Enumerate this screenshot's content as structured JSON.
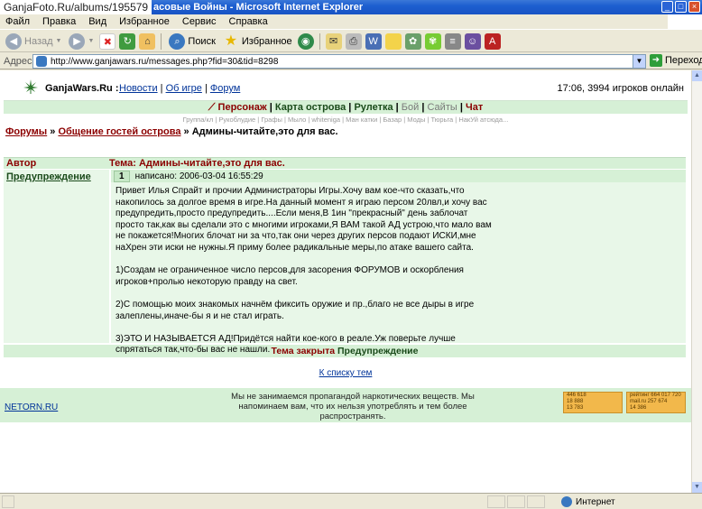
{
  "window": {
    "watermark": "GanjaFoto.Ru/albums/195579",
    "title": "Microsoft Internet Explorer",
    "title_fragment": "асовые Войны",
    "buttons": [
      "_",
      "□",
      "×"
    ]
  },
  "menu": [
    "Файл",
    "Правка",
    "Вид",
    "Избранное",
    "Сервис",
    "Справка"
  ],
  "toolbar": {
    "back": "Назад",
    "search": "Поиск",
    "favorites": "Избранное"
  },
  "address": {
    "label": "Адрес:",
    "url": "http://www.ganjawars.ru/messages.php?fid=30&tid=8298",
    "go": "Переход"
  },
  "site": {
    "logo": "GanjaWars.Ru",
    "logo_sep": ":",
    "nav": [
      "Новости",
      "Об игре",
      "Форум"
    ],
    "status": "17:06, 3994 игроков онлайн",
    "menu": [
      "Персонаж",
      "Карта острова",
      "Рулетка",
      "Бой",
      "Сайты",
      "Чат"
    ],
    "submenu": "Группа/кл | Рукоблудие | Графы | Мыло | whiteniga | Ман катки | Базар | Моды | Тюрьга | НакУй атсюда..."
  },
  "breadcrumb": {
    "forums": "Форумы",
    "sep": "»",
    "section": "Общение гостей острова",
    "topic": "Админы-читайте,это для вас."
  },
  "thread": {
    "col_author": "Автор",
    "col_topic_prefix": "Тема:",
    "topic": "Админы-читайте,это для вас.",
    "post": {
      "author": "Предупреждение",
      "number": "1",
      "meta": "написано: 2006-03-04 16:55:29",
      "paragraphs": [
        "Привет Илья Спрайт и прочии Администраторы Игры.Хочу вам кое-что сказать,что накопилось за долгое время в игре.На данный момент я играю персом 20лвл,и хочу вас предупредить,просто предупредить....Если меня,В 1ин \"прекрасный\" день заблочат просто так,как вы сделали это с многими игроками,Я ВАМ такой АД устрою,что мало вам не покажется!Многих блочат ни за что,так они через других персов подают ИСКИ,мне наХрен эти иски не нужны.Я приму более радикальные меры,по атаке вашего сайта.",
        "1)Создам не ограниченное число персов,для засорения ФОРУМОВ и оскорбления игроков+пролью некоторую правду на свет.",
        "2)С помощью моих знакомых начнём фиксить оружие и пр.,благо не все дыры в игре залеплены,иначе-бы я и не стал играть.",
        "3)ЭТО И НАЗЫВАЕТСЯ АД!Придётся найти кое-кого в реале.Уж поверьте лучше спрятаться так,что-бы вас не нашли."
      ]
    },
    "closed_label": "Тема закрыта",
    "closed_by": "Предупреждение"
  },
  "back_link": "К списку тем",
  "footer": {
    "left": "NETORN.RU",
    "disclaimer": "Мы не занимаемся пропагандой наркотических веществ. Мы напоминаем вам, что их нельзя употреблять и тем более распространять.",
    "counter1": [
      "446 618",
      "18 888",
      "13 783"
    ],
    "counter2": [
      "рейтинг 664 017 720",
      "mail.ru 257 674",
      "14 386"
    ]
  },
  "statusbar": {
    "zone": "Интернет"
  },
  "colors": {
    "accent_green": "#d6f0d6",
    "dark_red": "#8b0000",
    "link_blue": "#003399"
  }
}
